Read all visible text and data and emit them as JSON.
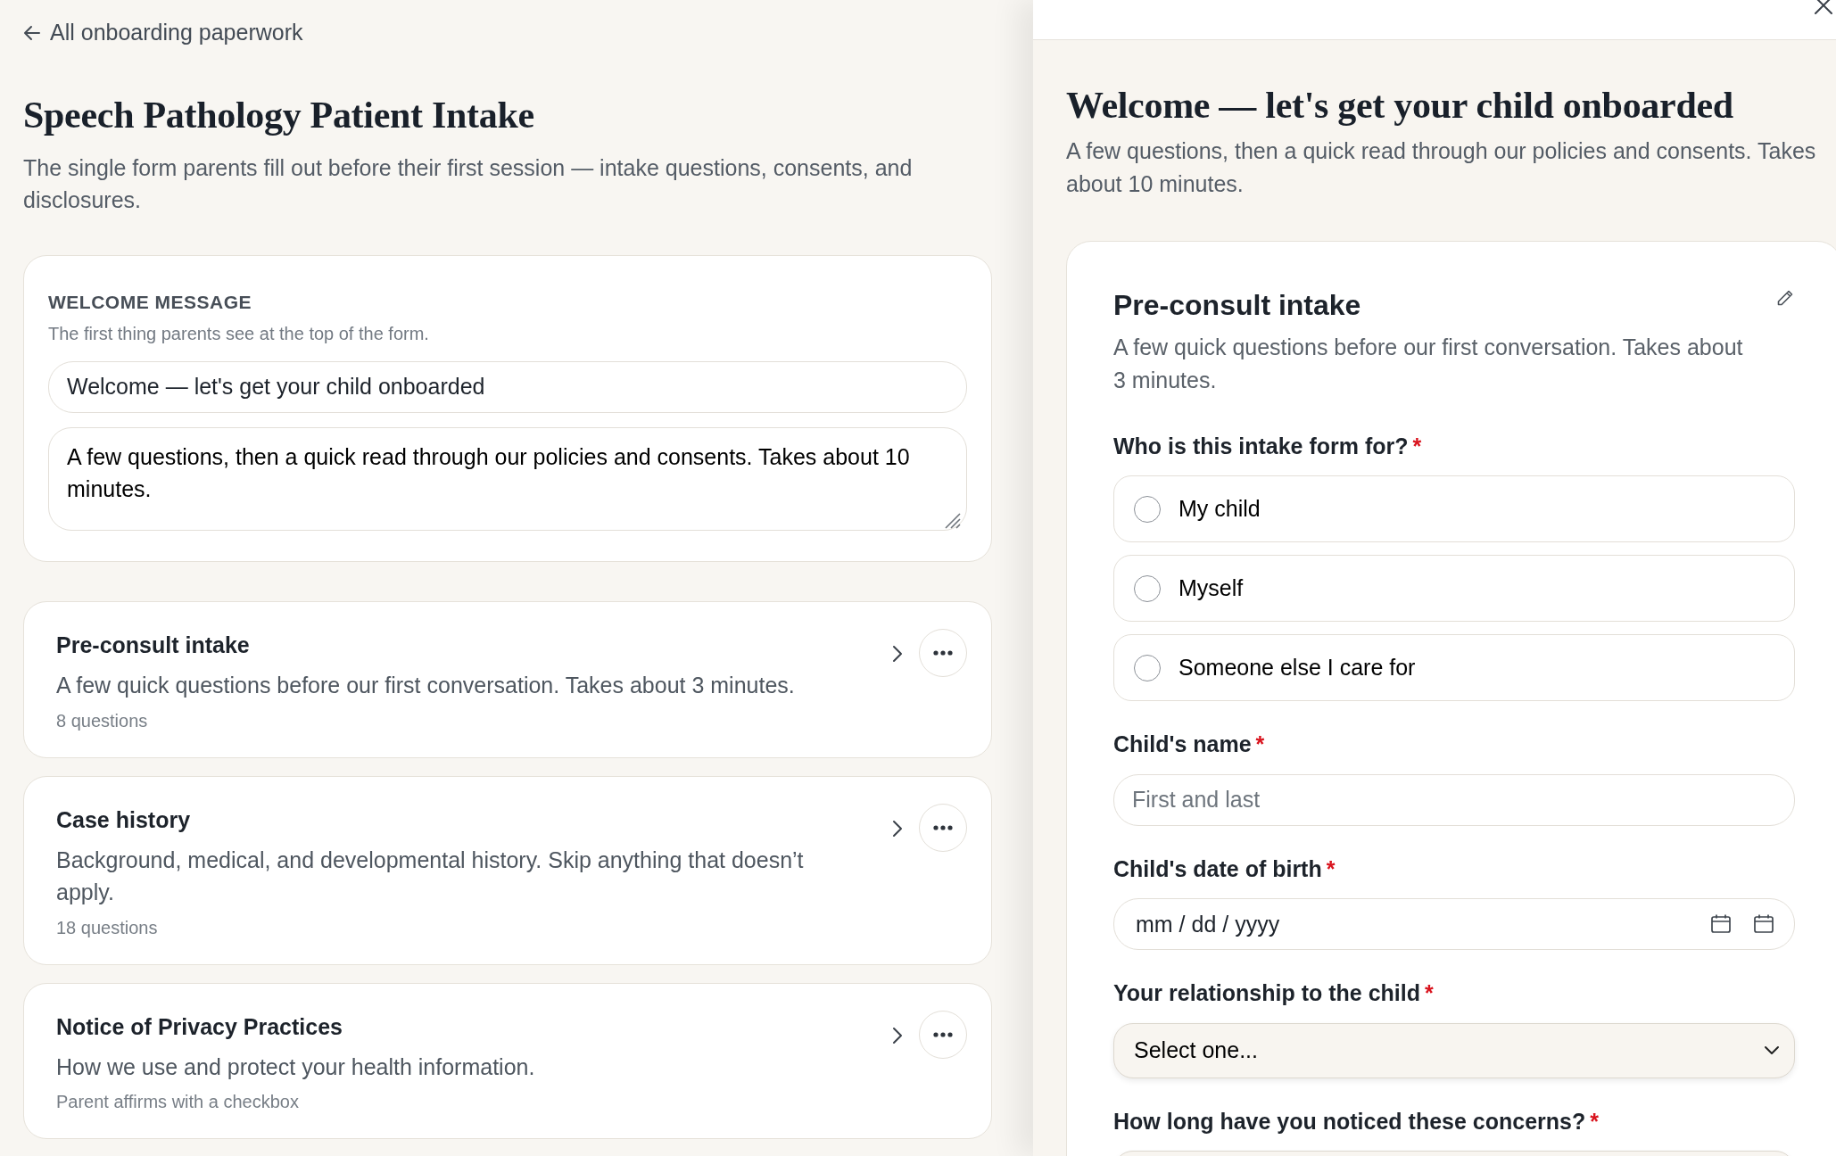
{
  "back_link": {
    "label": "All onboarding paperwork"
  },
  "page": {
    "title": "Speech Pathology Patient Intake",
    "subtitle": "The single form parents fill out before their first session — intake questions, consents, and disclosures."
  },
  "welcome_message": {
    "heading": "WELCOME MESSAGE",
    "hint": "The first thing parents see at the top of the form.",
    "title_value": "Welcome — let's get your child onboarded",
    "body_value": "A few questions, then a quick read through our policies and consents. Takes about 10 minutes."
  },
  "sections": [
    {
      "title": "Pre-consult intake",
      "description": "A few quick questions before our first conversation. Takes about 3 minutes.",
      "meta": "8 questions"
    },
    {
      "title": "Case history",
      "description": "Background, medical, and developmental history. Skip anything that doesn’t apply.",
      "meta": "18 questions"
    },
    {
      "title": "Notice of Privacy Practices",
      "description": "How we use and protect your health information.",
      "meta": "Parent affirms with a checkbox"
    }
  ],
  "preview": {
    "title": "Welcome — let's get your child onboarded",
    "subtitle": "A few questions, then a quick read through our policies and consents. Takes about 10 minutes.",
    "section": {
      "title": "Pre-consult intake",
      "description": "A few quick questions before our first conversation. Takes about 3 minutes.",
      "questions": [
        {
          "kind": "radio",
          "label": "Who is this intake form for?",
          "required_mark": "*",
          "options": [
            {
              "label": "My child",
              "selected": false
            },
            {
              "label": "Myself",
              "selected": false
            },
            {
              "label": "Someone else I care for",
              "selected": false
            }
          ]
        },
        {
          "kind": "text",
          "label": "Child's name",
          "required_mark": "*",
          "placeholder": "First and last"
        },
        {
          "kind": "date",
          "label": "Child's date of birth",
          "required_mark": "*",
          "placeholder": "mm / dd / yyyy"
        },
        {
          "kind": "select",
          "label": "Your relationship to the child",
          "required_mark": "*",
          "value": "Select one..."
        },
        {
          "kind": "select",
          "label": "How long have you noticed these concerns?",
          "required_mark": "*"
        }
      ]
    }
  }
}
